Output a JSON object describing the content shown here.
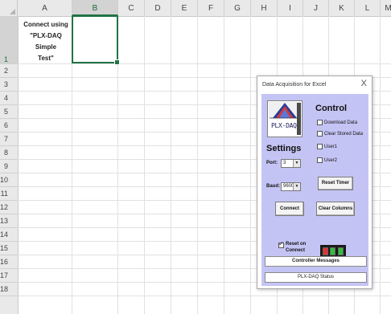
{
  "sheet": {
    "columns": [
      "A",
      "B",
      "C",
      "D",
      "E",
      "F",
      "G",
      "H",
      "I",
      "J",
      "K",
      "L",
      "M"
    ],
    "active_column": "B",
    "rows": [
      "1",
      "2",
      "3",
      "4",
      "5",
      "6",
      "7",
      "8",
      "9",
      "10",
      "11",
      "12",
      "13",
      "14",
      "15",
      "16",
      "17",
      "18"
    ],
    "active_row": "1",
    "a1_lines": [
      "Connect using",
      "\"PLX-DAQ Simple",
      "Test\""
    ]
  },
  "dialog": {
    "title": "Data Acquisition for Excel",
    "close_glyph": "X",
    "logo_text": "PLX-DAQ",
    "control_heading": "Control",
    "checkboxes": [
      {
        "label": "Download Data",
        "checked": false
      },
      {
        "label": "Clear Stored Data",
        "checked": false
      },
      {
        "label": "User1",
        "checked": false
      },
      {
        "label": "User2",
        "checked": false
      }
    ],
    "settings_heading": "Settings",
    "port_label": "Port:",
    "port_value": "3",
    "baud_label": "Baud:",
    "baud_value": "9600",
    "reset_timer_label": "Reset Timer",
    "connect_label": "Connect",
    "clear_columns_label": "Clear Columns",
    "reset_on_connect_lines": [
      "Reset on",
      "Connect"
    ],
    "reset_on_connect_checked": true,
    "leds": [
      {
        "name": "led-1",
        "color": "#e53030"
      },
      {
        "name": "led-2",
        "color": "#2fbf3a"
      },
      {
        "name": "led-3",
        "color": "#2fbf3a"
      }
    ],
    "controller_messages_label": "Controller Messages",
    "status_label": "PLX-DAQ Status"
  },
  "colors": {
    "selection": "#217346",
    "dialog_body": "#c4c4f4"
  }
}
